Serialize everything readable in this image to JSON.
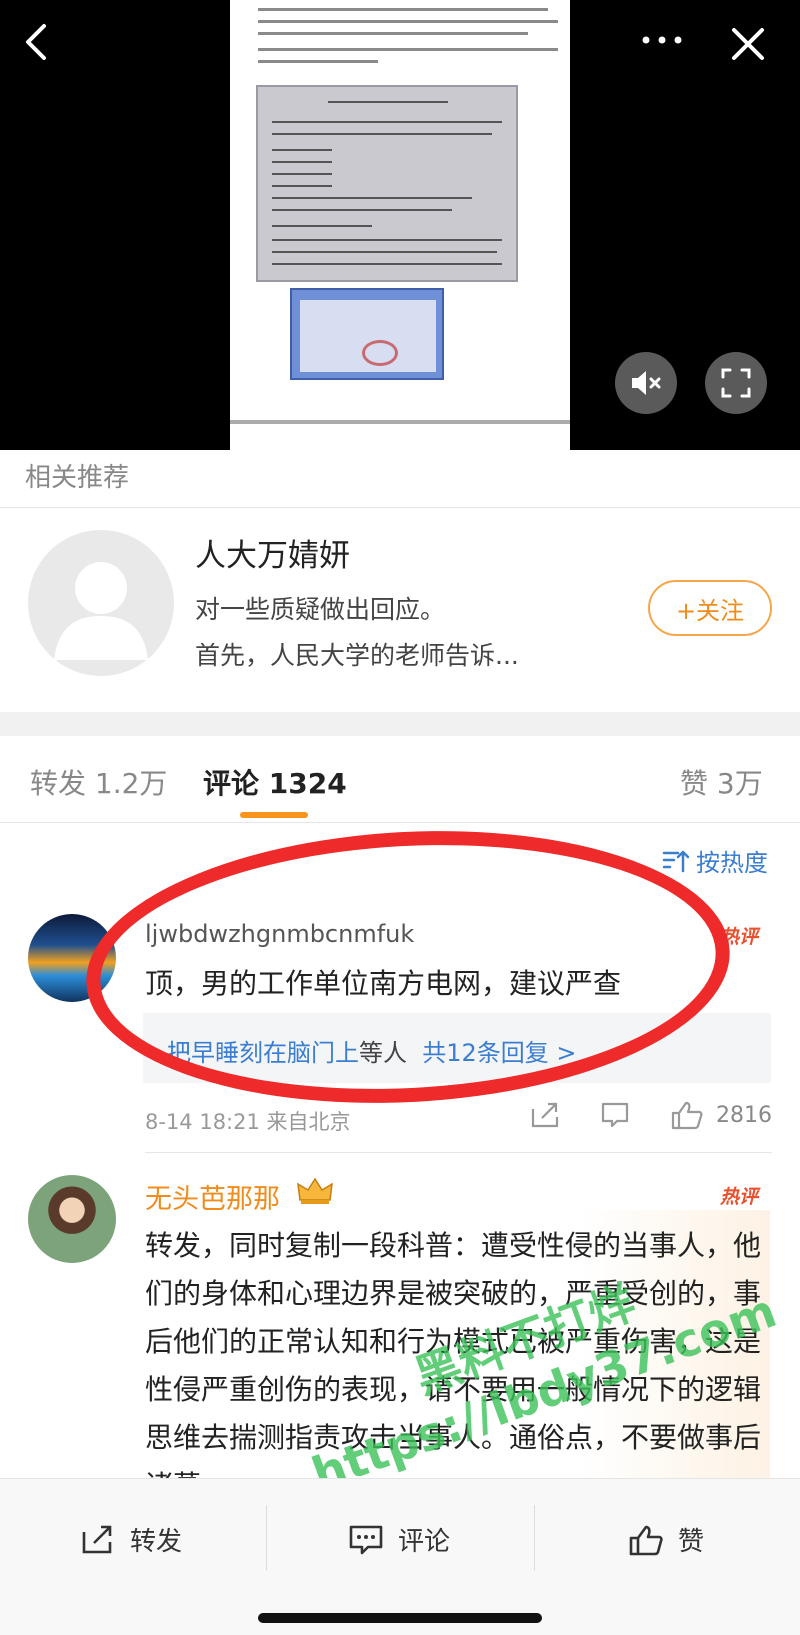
{
  "related": {
    "label": "相关推荐",
    "name": "人大万婧妍",
    "line1": "对一些质疑做出回应。",
    "line2": "首先，人民大学的老师告诉...",
    "follow": "+关注"
  },
  "tabs": {
    "repost": "转发 1.2万",
    "comments": "评论 1324",
    "likes": "赞 3万"
  },
  "sort": {
    "label": "按热度"
  },
  "comments": [
    {
      "user": "ljwbdwzhgnmbcnmfuk",
      "badge": "热评",
      "text": "顶，男的工作单位南方电网，建议严查",
      "reply_names": "把早睡刻在脑门上",
      "reply_mid": "等人",
      "reply_count": "共12条回复 >",
      "meta": "8-14 18:21 来自北京",
      "likes": "2816"
    },
    {
      "user": "无头芭那那",
      "badge": "热评",
      "text": "转发，同时复制一段科普：遭受性侵的当事人，他们的身体和心理边界是被突破的，严重受创的，事后他们的正常认知和行为模式已被严重伤害，这是性侵严重创伤的表现，请不要用一般情况下的逻辑思维去揣测指责攻击当事人。通俗点，不要做事后诸葛"
    }
  ],
  "watermark": {
    "line1": "黑料不打烊",
    "line2": "https://lbdy37.com"
  },
  "bottom": {
    "repost": "转发",
    "comment": "评论",
    "like": "赞"
  },
  "colors": {
    "accent": "#f7941d",
    "link": "#3b7ed0",
    "hot": "#e8512f",
    "annotation": "#ef2a2a"
  }
}
